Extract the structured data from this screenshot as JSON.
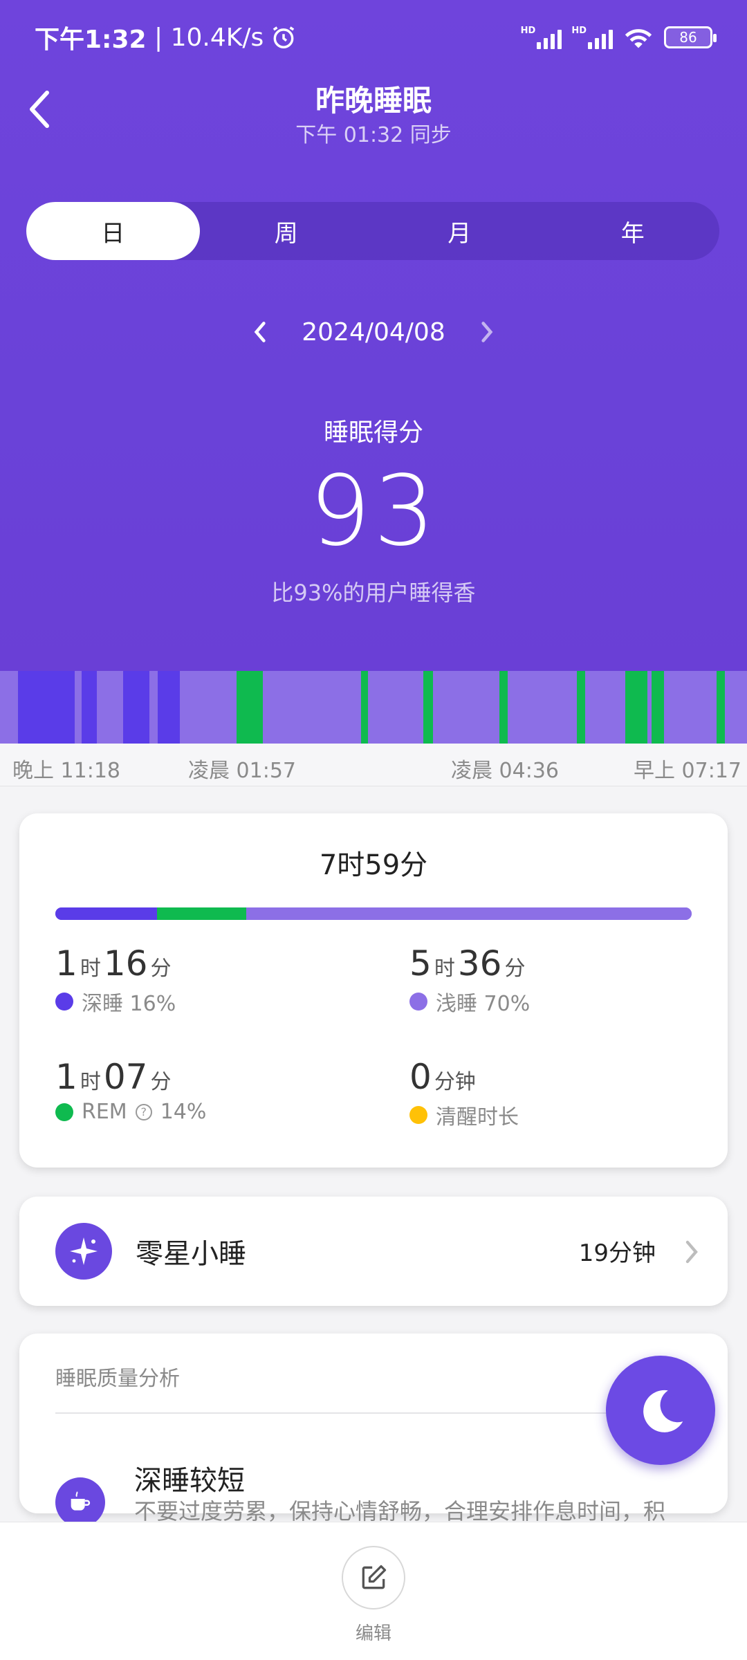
{
  "status_bar": {
    "time": "下午1:32",
    "speed": "10.4K/s",
    "battery": "86",
    "hd": "HD"
  },
  "header": {
    "title": "昨晚睡眠",
    "subtitle": "下午 01:32 同步"
  },
  "tabs": [
    {
      "label": "日",
      "active": true
    },
    {
      "label": "周",
      "active": false
    },
    {
      "label": "月",
      "active": false
    },
    {
      "label": "年",
      "active": false
    }
  ],
  "date": "2024/04/08",
  "score": {
    "label": "睡眠得分",
    "value": "93",
    "description": "比93%的用户睡得香"
  },
  "timeline": {
    "labels": [
      "晚上 11:18",
      "凌晨 01:57",
      "凌晨 04:36",
      "早上 07:17"
    ],
    "colors": {
      "deep": "#5a3ce8",
      "light": "#8c6fe6",
      "rem": "#0fba4f"
    }
  },
  "summary": {
    "total": "7时59分",
    "distribution": {
      "deep": 16,
      "rem": 14,
      "light": 70
    },
    "stats": [
      {
        "num1": "1",
        "unit1": "时",
        "num2": "16",
        "unit2": "分",
        "label": "深睡 16%",
        "color": "#5a3ce8"
      },
      {
        "num1": "5",
        "unit1": "时",
        "num2": "36",
        "unit2": "分",
        "label": "浅睡 70%",
        "color": "#8c6fe6"
      },
      {
        "num1": "1",
        "unit1": "时",
        "num2": "07",
        "unit2": "分",
        "label_prefix": "REM",
        "label_suffix": "14%",
        "color": "#0fba4f"
      },
      {
        "num1": "0",
        "unit1": "分钟",
        "label": "清醒时长",
        "color": "#ffc107"
      }
    ]
  },
  "nap": {
    "label": "零星小睡",
    "value": "19分钟"
  },
  "analysis": {
    "title": "睡眠质量分析",
    "item_title": "深睡较短",
    "item_body": "不要过度劳累，保持心情舒畅，合理安排作息时间，积"
  },
  "bottom": {
    "edit_label": "编辑"
  },
  "accent": "#6c4ae4"
}
